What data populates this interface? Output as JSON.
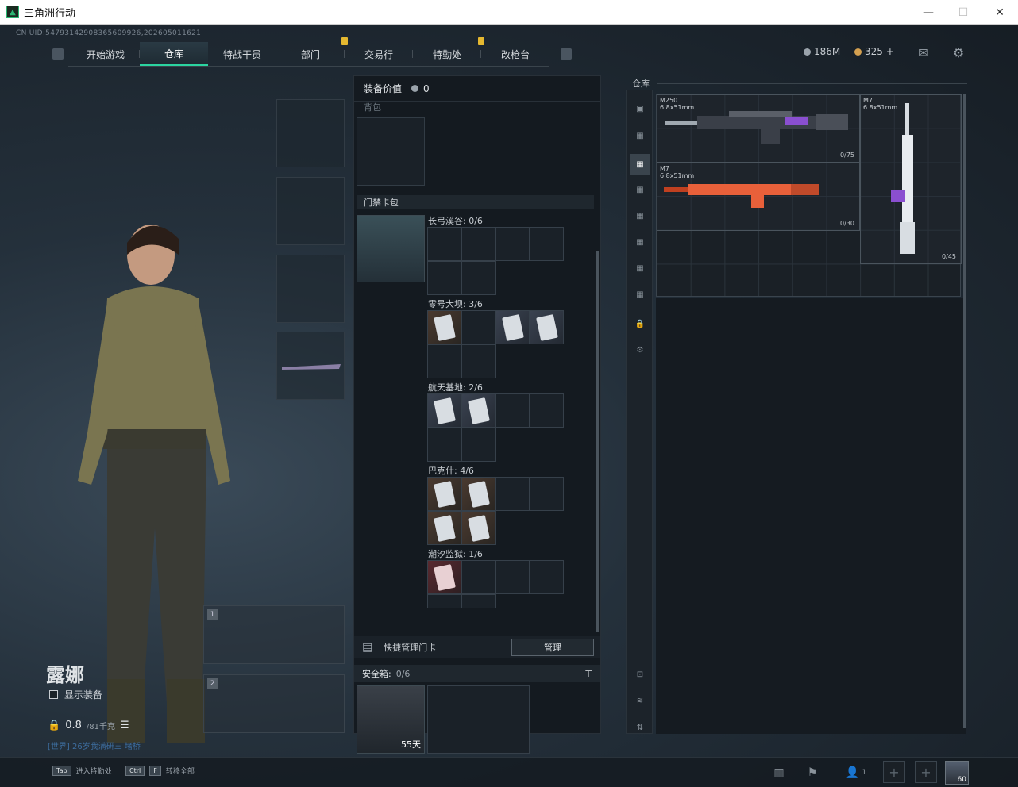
{
  "window": {
    "title": "三角洲行动",
    "minimize": "—",
    "maximize": "☐",
    "close": "✕"
  },
  "uid": "CN UID:54793142908365609926,202605011621",
  "nav": {
    "tabs": [
      {
        "label": "开始游戏",
        "active": false,
        "notif": false
      },
      {
        "label": "仓库",
        "active": true,
        "notif": false
      },
      {
        "label": "特战干员",
        "active": false,
        "notif": false
      },
      {
        "label": "部门",
        "active": false,
        "notif": true
      },
      {
        "label": "交易行",
        "active": false,
        "notif": false
      },
      {
        "label": "特勤处",
        "active": false,
        "notif": true
      },
      {
        "label": "改枪台",
        "active": false,
        "notif": false
      }
    ],
    "left_key": "Q",
    "right_key": "E"
  },
  "currency": {
    "money": "186M",
    "coins": "325",
    "plus": "+"
  },
  "character": {
    "name": "露娜",
    "show_equipment": "显示装备",
    "weight": "0.8",
    "weight_max": "/81千克",
    "world_msg": "[世界] 26岁我满研三 堵桥"
  },
  "weapon_slots": [
    "1",
    "2"
  ],
  "middle": {
    "equip_value_label": "装备价值",
    "equip_value": "0",
    "backpack_label": "背包",
    "keycard_label": "门禁卡包",
    "maps": [
      {
        "label": "长弓溪谷: 0/6",
        "cards": []
      },
      {
        "label": "零号大坝: 3/6",
        "cards": [
          "card",
          "blue",
          "blue"
        ]
      },
      {
        "label": "航天基地: 2/6",
        "cards": [
          "blue",
          "blue"
        ]
      },
      {
        "label": "巴克什: 4/6",
        "cards": [
          "card",
          "card",
          "card",
          "card"
        ]
      },
      {
        "label": "潮汐监狱: 1/6",
        "cards": [
          "red"
        ]
      }
    ],
    "quick_manage": "快捷管理门卡",
    "manage_btn": "管理",
    "safe_label": "安全箱:",
    "safe_count": "0/6",
    "safe_days": "55天"
  },
  "warehouse": {
    "title": "仓库",
    "weapons": [
      {
        "name": "M250",
        "caliber": "6.8x51mm",
        "ammo": "0/75"
      },
      {
        "name": "M7",
        "caliber": "6.8x51mm",
        "ammo": "0/30"
      },
      {
        "name": "M7",
        "caliber": "6.8x51mm",
        "ammo": "0/45"
      }
    ]
  },
  "bottom": {
    "hint1_key": "Tab",
    "hint1_text": "进入特勤处",
    "hint2_key1": "Ctrl",
    "hint2_key2": "F",
    "hint2_text": "转移全部",
    "friends_count": "1",
    "level": "60"
  }
}
